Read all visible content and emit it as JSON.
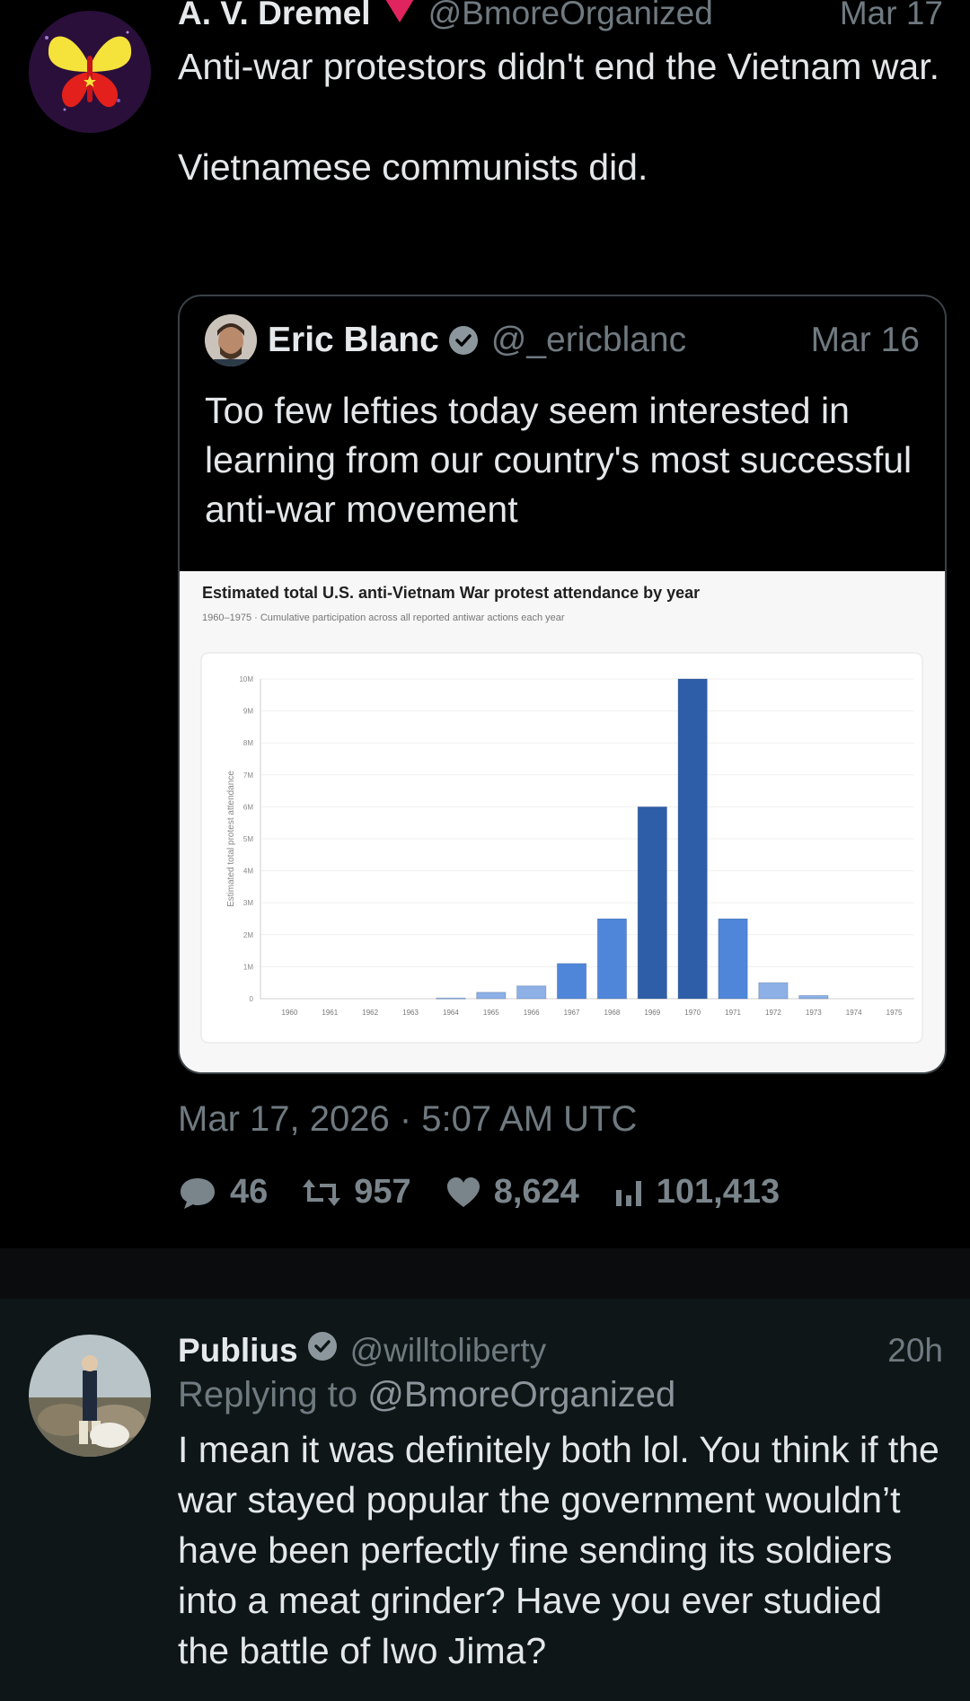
{
  "tweet": {
    "author_name": "A. V. Dremel",
    "author_handle": "@BmoreOrganized",
    "date": "Mar 17",
    "text": "Anti-war protestors didn't end the Vietnam war.\n\nVietnamese communists did.",
    "timestamp": "Mar 17, 2026 · 5:07 AM UTC",
    "stats": {
      "replies": "46",
      "retweets": "957",
      "likes": "8,624",
      "views": "101,413"
    },
    "icons": [
      "comment-icon",
      "retweet-icon",
      "heart-icon",
      "views-icon"
    ]
  },
  "quote": {
    "author_name": "Eric Blanc",
    "author_handle": "@_ericblanc",
    "date": "Mar 16",
    "text": "Too few lefties today seem interested in learning from our country's most successful anti-war movement"
  },
  "chart_data": {
    "type": "bar",
    "title": "Estimated total U.S. anti-Vietnam War protest attendance by year",
    "subtitle": "1960–1975 · Cumulative participation across all reported antiwar actions each year",
    "ylabel": "Estimated total protest attendance",
    "xlabel": "",
    "categories": [
      "1960",
      "1961",
      "1962",
      "1963",
      "1964",
      "1965",
      "1966",
      "1967",
      "1968",
      "1969",
      "1970",
      "1971",
      "1972",
      "1973",
      "1974",
      "1975"
    ],
    "values": [
      0,
      0,
      0,
      0,
      20000,
      200000,
      400000,
      1100000,
      2500000,
      6000000,
      10000000,
      2500000,
      500000,
      100000,
      0,
      0
    ],
    "ylim": [
      0,
      10000000
    ],
    "yticks": [
      "0",
      "1M",
      "2M",
      "3M",
      "4M",
      "5M",
      "6M",
      "7M",
      "8M",
      "9M",
      "10M"
    ],
    "grid": true,
    "colors": {
      "light": "#8db1e6",
      "mid": "#4f86d9",
      "dark": "#2f5ea8"
    }
  },
  "reply": {
    "author_name": "Publius",
    "author_handle": "@willtoliberty",
    "date": "20h",
    "replying_prefix": "Replying to",
    "replying_to": "@BmoreOrganized",
    "text": "I mean it was definitely both lol. You think if the war stayed popular the government wouldn’t have been perfectly fine sending its soldiers into a meat grinder? Have you ever studied the battle of Iwo Jima?"
  },
  "colors": {
    "background": "#000000",
    "reply_background": "#0e1617",
    "muted": "#6f7a80",
    "verified": "#8c979d",
    "flag": "#e0245e"
  }
}
